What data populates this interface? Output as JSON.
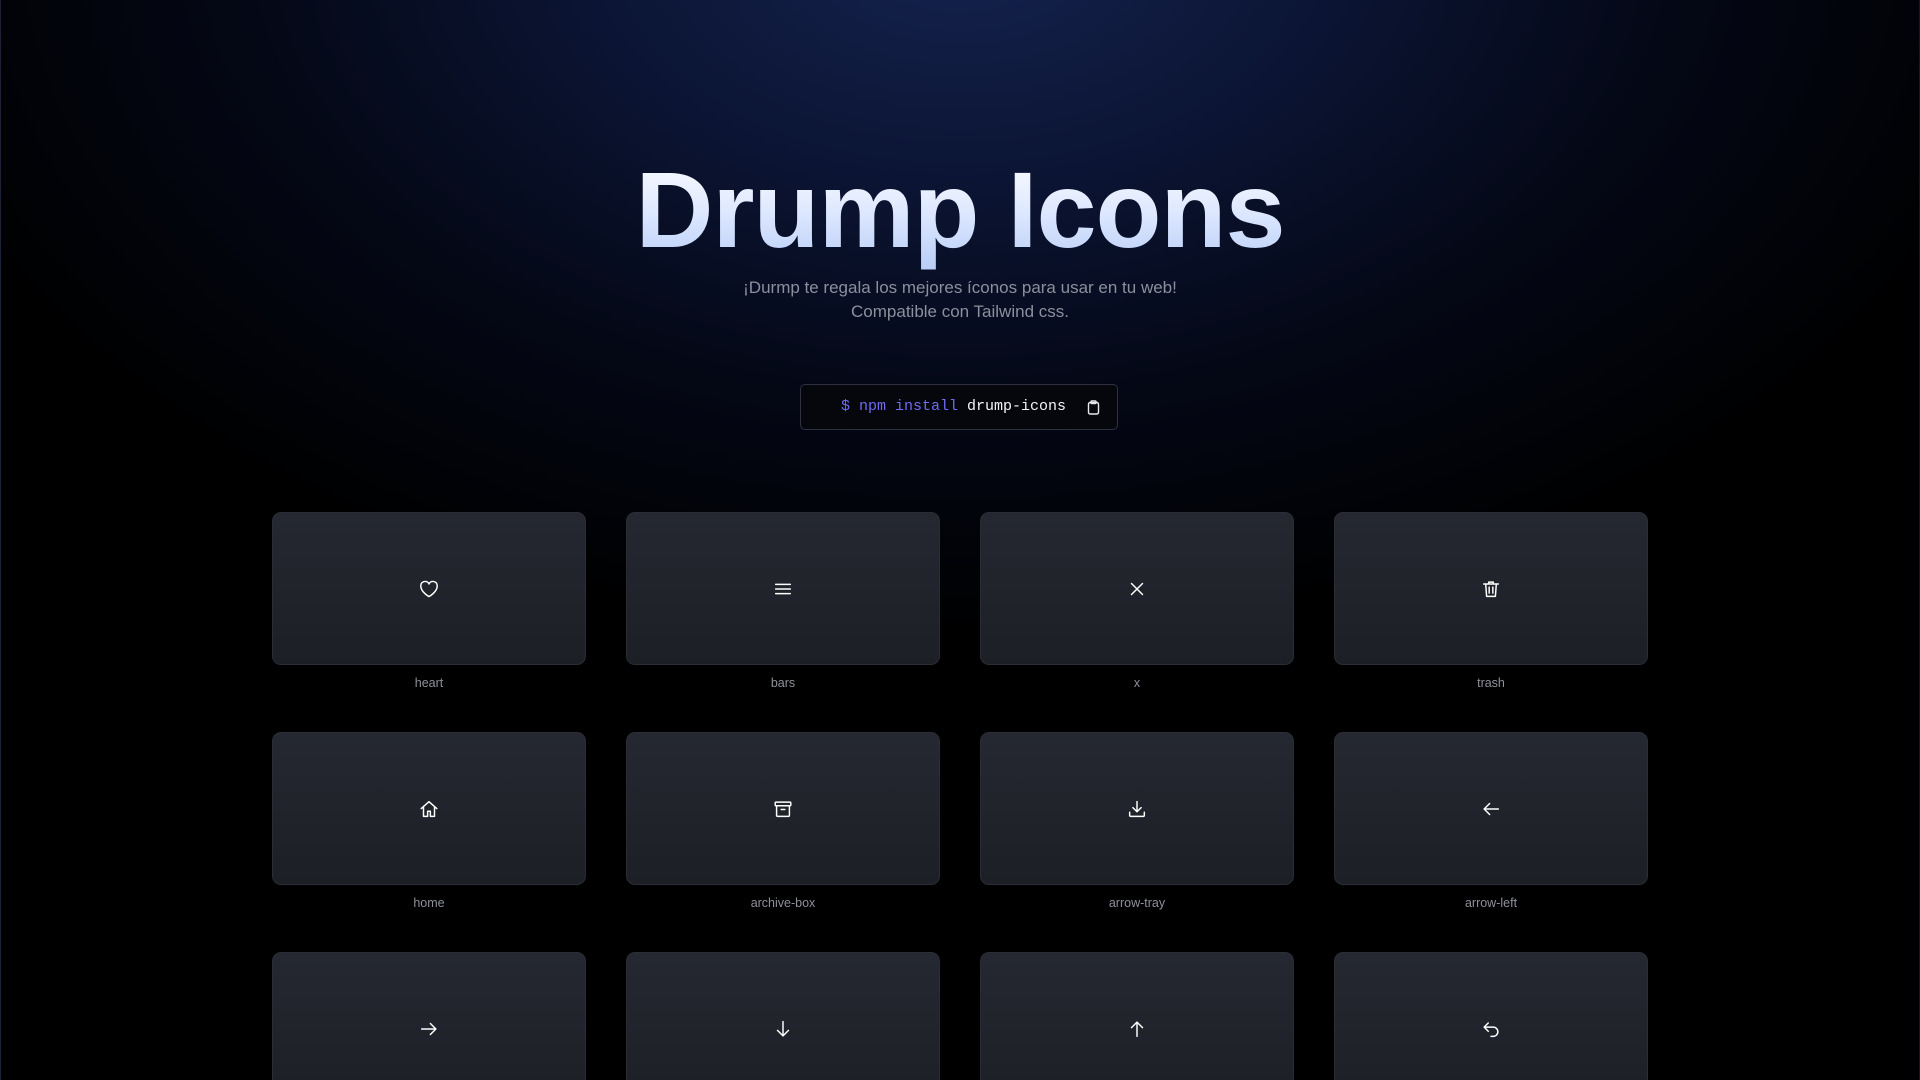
{
  "hero": {
    "title": "Drump Icons",
    "subtitle_line1": "¡Durmp te regala los mejores íconos para usar en tu web!",
    "subtitle_line2": "Compatible con Tailwind css."
  },
  "install": {
    "prefix": "$ npm install",
    "package": "drump-icons",
    "copy_icon": "clipboard-icon"
  },
  "colors": {
    "accent_command": "#6f6bf0",
    "card_background": "#22252d",
    "page_background": "#000000",
    "glow": "#15234f"
  },
  "icons": [
    {
      "label": "heart",
      "icon": "heart-icon"
    },
    {
      "label": "bars",
      "icon": "bars-icon"
    },
    {
      "label": "x",
      "icon": "x-icon"
    },
    {
      "label": "trash",
      "icon": "trash-icon"
    },
    {
      "label": "home",
      "icon": "home-icon"
    },
    {
      "label": "archive-box",
      "icon": "archive-box-icon"
    },
    {
      "label": "arrow-tray",
      "icon": "arrow-tray-icon"
    },
    {
      "label": "arrow-left",
      "icon": "arrow-left-icon"
    },
    {
      "label": "",
      "icon": "arrow-right-icon"
    },
    {
      "label": "",
      "icon": "arrow-down-icon"
    },
    {
      "label": "",
      "icon": "arrow-up-icon"
    },
    {
      "label": "",
      "icon": "arrow-uturn-left-icon"
    }
  ]
}
